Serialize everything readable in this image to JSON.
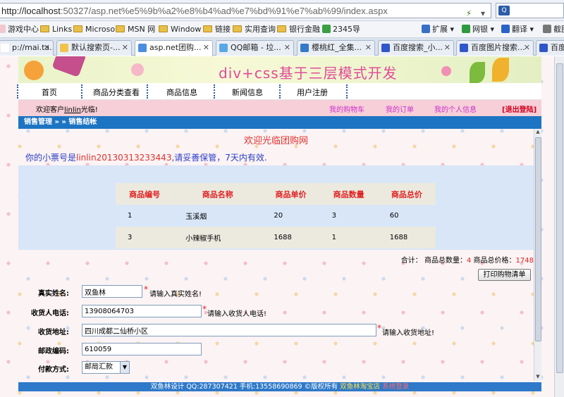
{
  "browser": {
    "url_host": "http://localhost",
    "url_rest": ":50327/asp.net%e5%9b%a2%e8%b4%ad%e7%bd%91%e7%ab%99/index.aspx",
    "search_placeholder": "",
    "favorites": [
      "游戏中心",
      "Links",
      "Microso",
      "MSN 网",
      "Window",
      "链接",
      "实用查询",
      "银行金融",
      "2345导"
    ],
    "right_tools": [
      "扩展",
      "网银",
      "翻译",
      "截图"
    ],
    "tabs": [
      {
        "label": "p://mai.ta...",
        "active": false
      },
      {
        "label": "默认搜索页-...",
        "active": false
      },
      {
        "label": "asp.net团购...",
        "active": true
      },
      {
        "label": "QQ邮箱 - 垃...",
        "active": false
      },
      {
        "label": "樱桃红_全集...",
        "active": false
      },
      {
        "label": "百度搜索_小...",
        "active": false
      },
      {
        "label": "百度图片搜索...",
        "active": false
      },
      {
        "label": "百度",
        "active": false
      }
    ]
  },
  "site": {
    "banner_title": "div+css基于三层模式开发",
    "nav": [
      "首页",
      "商品分类查看",
      "商品信息",
      "新闻信息",
      "用户注册"
    ],
    "welcome": {
      "prefix": "欢迎客户",
      "user": "linlin",
      "suffix": "光临!",
      "cart": "我的购物车",
      "orders": "我的订单",
      "profile": "我的个人信息",
      "logout": "[退出登陆]"
    },
    "breadcrumb": "销售管理 » » 销售结帐"
  },
  "checkout": {
    "heading": "欢迎光临团购网",
    "ticket_prefix": "你的小票号是",
    "ticket_no": "linlin20130313233443",
    "ticket_suffix": ",请妥善保管，7天内有效.",
    "columns": [
      "商品编号",
      "商品名称",
      "商品单价",
      "商品数量",
      "商品总价"
    ],
    "rows": [
      [
        "1",
        "玉溪烟",
        "20",
        "3",
        "60"
      ],
      [
        "3",
        "小辣椒手机",
        "1688",
        "1",
        "1688"
      ]
    ],
    "summary_label": "合计：  商品总数量：",
    "total_qty": "4",
    "summary_price_label": "  商品总价格：",
    "total_price": "1748",
    "print_label": "打印购物清单"
  },
  "form": {
    "name_label": "真实姓名:",
    "name_value": "双鱼林",
    "name_hint": "请输入真实姓名!",
    "phone_label": "收货人电话:",
    "phone_value": "13908064703",
    "phone_hint": "请输入收货人电话!",
    "address_label": "收货地址:",
    "address_value": "四川成都二仙桥小区",
    "address_hint": "请输入收货地址!",
    "postcode_label": "邮政编码:",
    "postcode_value": "610059",
    "payment_label": "付款方式:",
    "payment_value": "邮局汇款"
  },
  "footer": {
    "text": "双鱼林设计 QQ:287307421 手机:13558690869 ©版权所有",
    "shop": "双鱼林淘宝店",
    "admin": "系统登录"
  }
}
